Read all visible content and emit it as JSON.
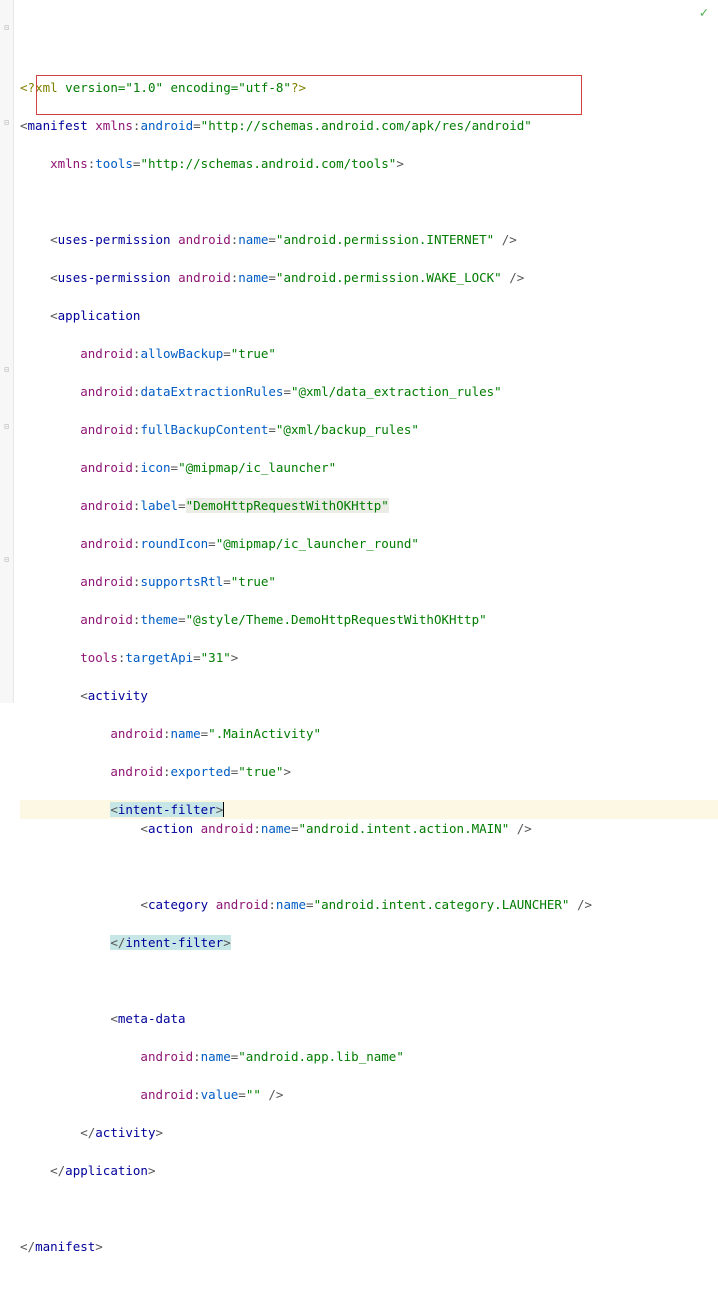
{
  "xml_decl": {
    "open": "<?",
    "name": "xml",
    "attrs": "version=\"1.0\" encoding=\"utf-8\"",
    "close": "?>"
  },
  "manifest": {
    "open_tag": "manifest",
    "ns1": {
      "prefix": "xmlns",
      "name": "android",
      "value": "\"http://schemas.android.com/apk/res/android\""
    },
    "ns2": {
      "prefix": "xmlns",
      "name": "tools",
      "value": "\"http://schemas.android.com/tools\""
    },
    "close": "</",
    "close_tag": "manifest",
    "close_end": ">"
  },
  "perm1": {
    "tag": "uses-permission",
    "attr_ns": "android",
    "attr_name": "name",
    "value": "\"android.permission.INTERNET\"",
    "end": " />"
  },
  "perm2": {
    "tag": "uses-permission",
    "attr_ns": "android",
    "attr_name": "name",
    "value": "\"android.permission.WAKE_LOCK\"",
    "end": " />"
  },
  "application": {
    "open": "<",
    "tag": "application",
    "allowBackup": {
      "ns": "android",
      "name": "allowBackup",
      "value": "\"true\""
    },
    "dataExtractionRules": {
      "ns": "android",
      "name": "dataExtractionRules",
      "value": "\"@xml/data_extraction_rules\""
    },
    "fullBackupContent": {
      "ns": "android",
      "name": "fullBackupContent",
      "value": "\"@xml/backup_rules\""
    },
    "icon": {
      "ns": "android",
      "name": "icon",
      "value": "\"@mipmap/ic_launcher\""
    },
    "label": {
      "ns": "android",
      "name": "label",
      "value": "\"DemoHttpRequestWithOKHttp\""
    },
    "roundIcon": {
      "ns": "android",
      "name": "roundIcon",
      "value": "\"@mipmap/ic_launcher_round\""
    },
    "supportsRtl": {
      "ns": "android",
      "name": "supportsRtl",
      "value": "\"true\""
    },
    "theme": {
      "ns": "android",
      "name": "theme",
      "value": "\"@style/Theme.DemoHttpRequestWithOKHttp\""
    },
    "targetApi": {
      "ns": "tools",
      "name": "targetApi",
      "value": "\"31\"",
      "end": ">"
    },
    "close": "</",
    "close_tag": "application",
    "close_end": ">"
  },
  "activity": {
    "open": "<",
    "tag": "activity",
    "name": {
      "ns": "android",
      "name": "name",
      "value": "\".MainActivity\""
    },
    "exported": {
      "ns": "android",
      "name": "exported",
      "value": "\"true\"",
      "end": ">"
    },
    "close": "</",
    "close_tag": "activity",
    "close_end": ">"
  },
  "intent_filter": {
    "open": "<",
    "tag": "intent-filter",
    "end": ">",
    "close": "</",
    "close_tag": "intent-filter",
    "close_end": ">"
  },
  "action": {
    "open": "<",
    "tag": "action",
    "ns": "android",
    "attr": "name",
    "value": "\"android.intent.action.MAIN\"",
    "end": " />"
  },
  "category": {
    "open": "<",
    "tag": "category",
    "ns": "android",
    "attr": "name",
    "value": "\"android.intent.category.LAUNCHER\"",
    "end": " />"
  },
  "meta_data": {
    "open": "<",
    "tag": "meta-data",
    "name": {
      "ns": "android",
      "name": "name",
      "value": "\"android.app.lib_name\""
    },
    "value": {
      "ns": "android",
      "name": "value",
      "val": "\"\"",
      "end": " />"
    }
  }
}
